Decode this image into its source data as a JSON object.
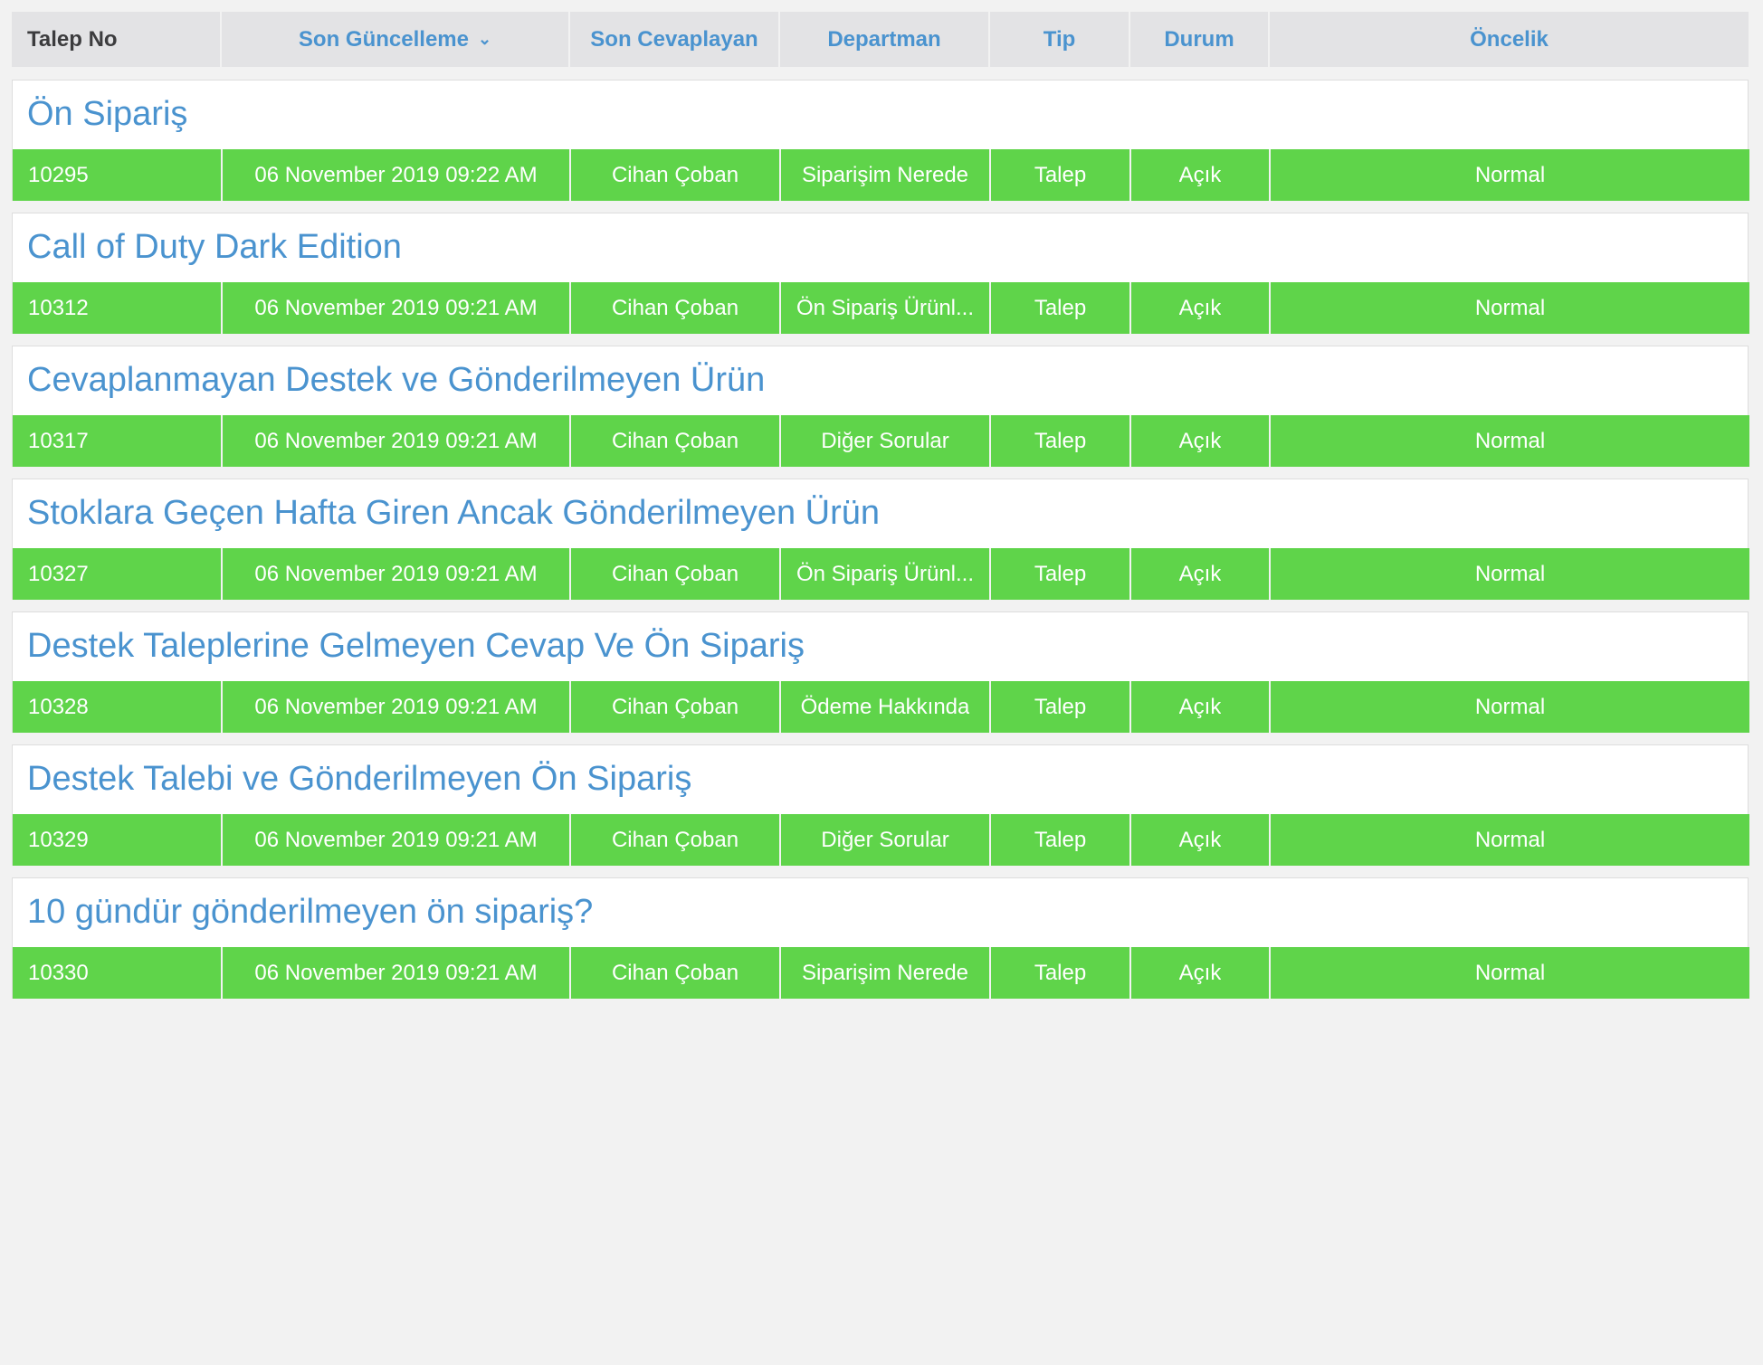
{
  "colors": {
    "accent_blue": "#4a93cf",
    "row_green": "#5fd44a",
    "header_gray": "#e3e3e5",
    "page_background": "#f2f2f2",
    "row_text": "#ffffff"
  },
  "table": {
    "columns": [
      {
        "key": "talep_no",
        "label": "Talep No",
        "sorted": false
      },
      {
        "key": "son_guncelleme",
        "label": "Son Güncelleme",
        "sorted": true,
        "sort_icon": "chevron-down-icon"
      },
      {
        "key": "son_cevaplayan",
        "label": "Son Cevaplayan",
        "sorted": false
      },
      {
        "key": "departman",
        "label": "Departman",
        "sorted": false
      },
      {
        "key": "tip",
        "label": "Tip",
        "sorted": false
      },
      {
        "key": "durum",
        "label": "Durum",
        "sorted": false
      },
      {
        "key": "oncelik",
        "label": "Öncelik",
        "sorted": false
      }
    ],
    "groups": [
      {
        "title": "Ön Sipariş",
        "talep_no": "10295",
        "son_guncelleme": "06 November 2019 09:22 AM",
        "son_cevaplayan": "Cihan Çoban",
        "departman": "Siparişim Nerede",
        "tip": "Talep",
        "durum": "Açık",
        "oncelik": "Normal"
      },
      {
        "title": "Call of Duty Dark Edition",
        "talep_no": "10312",
        "son_guncelleme": "06 November 2019 09:21 AM",
        "son_cevaplayan": "Cihan Çoban",
        "departman": "Ön Sipariş Ürünl...",
        "tip": "Talep",
        "durum": "Açık",
        "oncelik": "Normal"
      },
      {
        "title": "Cevaplanmayan Destek ve Gönderilmeyen Ürün",
        "talep_no": "10317",
        "son_guncelleme": "06 November 2019 09:21 AM",
        "son_cevaplayan": "Cihan Çoban",
        "departman": "Diğer Sorular",
        "tip": "Talep",
        "durum": "Açık",
        "oncelik": "Normal"
      },
      {
        "title": "Stoklara Geçen Hafta Giren Ancak Gönderilmeyen Ürün",
        "talep_no": "10327",
        "son_guncelleme": "06 November 2019 09:21 AM",
        "son_cevaplayan": "Cihan Çoban",
        "departman": "Ön Sipariş Ürünl...",
        "tip": "Talep",
        "durum": "Açık",
        "oncelik": "Normal"
      },
      {
        "title": "Destek Taleplerine Gelmeyen Cevap Ve Ön Sipariş",
        "talep_no": "10328",
        "son_guncelleme": "06 November 2019 09:21 AM",
        "son_cevaplayan": "Cihan Çoban",
        "departman": "Ödeme Hakkında",
        "tip": "Talep",
        "durum": "Açık",
        "oncelik": "Normal"
      },
      {
        "title": "Destek Talebi ve Gönderilmeyen Ön Sipariş",
        "talep_no": "10329",
        "son_guncelleme": "06 November 2019 09:21 AM",
        "son_cevaplayan": "Cihan Çoban",
        "departman": "Diğer Sorular",
        "tip": "Talep",
        "durum": "Açık",
        "oncelik": "Normal"
      },
      {
        "title": "10 gündür gönderilmeyen ön sipariş?",
        "talep_no": "10330",
        "son_guncelleme": "06 November 2019 09:21 AM",
        "son_cevaplayan": "Cihan Çoban",
        "departman": "Siparişim Nerede",
        "tip": "Talep",
        "durum": "Açık",
        "oncelik": "Normal"
      }
    ]
  }
}
